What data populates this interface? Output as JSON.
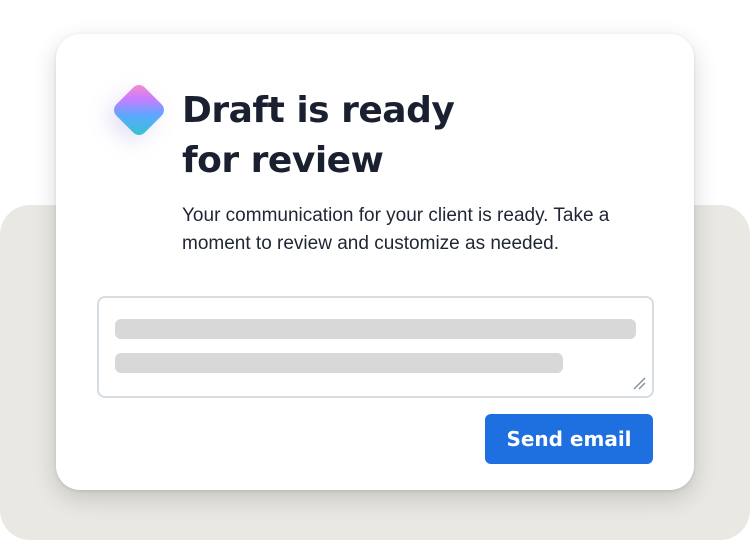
{
  "card": {
    "logo_icon": "gradient-diamond-icon",
    "title_line1": "Draft is ready",
    "title_line2": "for review",
    "description": "Your communication for your client is ready. Take a moment to review and customize as needed."
  },
  "draft": {
    "resize_icon": "resize-handle-icon"
  },
  "actions": {
    "send_label": "Send email"
  },
  "colors": {
    "primary": "#1e6fdf",
    "title": "#1b2030",
    "text": "#1f2533",
    "backdrop": "#e9e8e3",
    "skeleton": "#d8d8d8"
  }
}
